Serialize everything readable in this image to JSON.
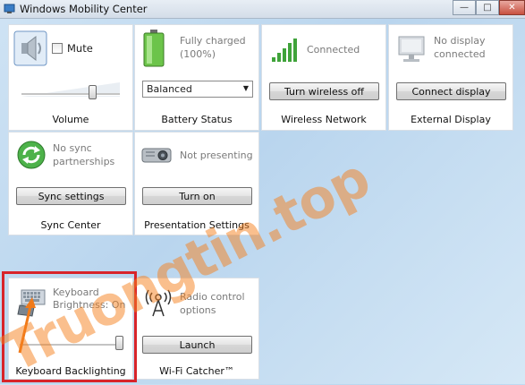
{
  "window": {
    "title": "Windows Mobility Center",
    "minimize_glyph": "—",
    "maximize_glyph": "□",
    "close_glyph": "✕"
  },
  "tiles": {
    "volume": {
      "name": "Volume",
      "mute_label": "Mute",
      "muted": false,
      "level": 0.72
    },
    "battery": {
      "name": "Battery Status",
      "status": "Fully charged (100%)",
      "plan": "Balanced"
    },
    "wireless": {
      "name": "Wireless Network",
      "status": "Connected",
      "button": "Turn wireless off"
    },
    "display": {
      "name": "External Display",
      "status": "No display connected",
      "button": "Connect display"
    },
    "sync": {
      "name": "Sync Center",
      "status": "No sync partnerships",
      "button": "Sync settings"
    },
    "presentation": {
      "name": "Presentation Settings",
      "status": "Not presenting",
      "button": "Turn on"
    },
    "keyboard": {
      "name": "Keyboard Backlighting",
      "status": "Keyboard Brightness: On",
      "level": 1.0
    },
    "wifi_catcher": {
      "name": "Wi-Fi Catcher™",
      "status": "Radio control options",
      "button": "Launch"
    }
  },
  "watermark": "Truongtin.top",
  "colors": {
    "highlight": "#d8242a",
    "arrow": "#f07a1a",
    "watermark": "#f6801c"
  },
  "icons": [
    "speaker-icon",
    "battery-icon",
    "signal-bars-icon",
    "monitor-icon",
    "sync-icon",
    "projector-icon",
    "keyboard-icon",
    "wifi-catcher-icon"
  ]
}
